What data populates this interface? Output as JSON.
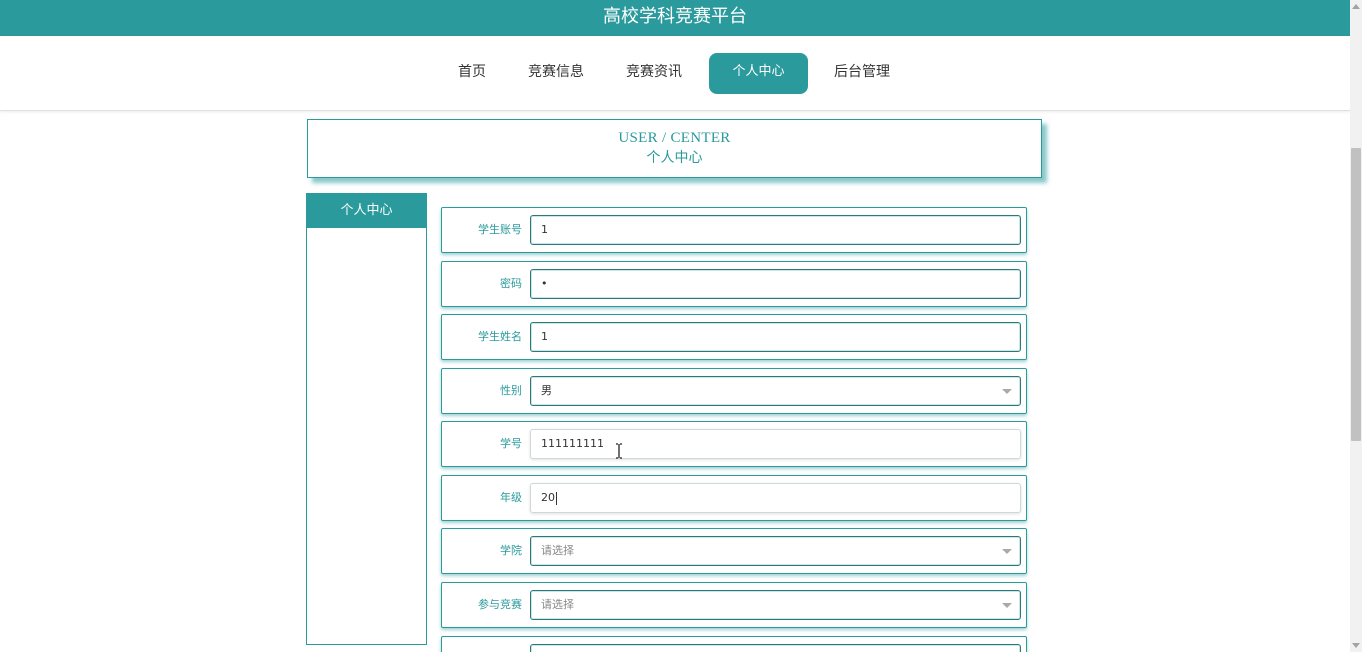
{
  "header": {
    "title": "高校学科竞赛平台"
  },
  "nav": {
    "items": [
      {
        "label": "首页"
      },
      {
        "label": "竞赛信息"
      },
      {
        "label": "竞赛资讯"
      },
      {
        "label": "个人中心",
        "active": true
      },
      {
        "label": "后台管理"
      }
    ]
  },
  "banner": {
    "en": "USER / CENTER",
    "cn": "个人中心"
  },
  "sidebar": {
    "items": [
      {
        "label": "个人中心"
      }
    ]
  },
  "form": {
    "rows": [
      {
        "label": "学生账号",
        "value": "1",
        "type": "text"
      },
      {
        "label": "密码",
        "value": "•",
        "type": "password"
      },
      {
        "label": "学生姓名",
        "value": "1",
        "type": "text"
      },
      {
        "label": "性别",
        "value": "男",
        "type": "select"
      },
      {
        "label": "学号",
        "value": "111111111",
        "type": "text"
      },
      {
        "label": "年级",
        "value": "20",
        "type": "text"
      },
      {
        "label": "学院",
        "value": "请选择",
        "type": "select",
        "placeholder": true
      },
      {
        "label": "参与竞赛",
        "value": "请选择",
        "type": "select",
        "placeholder": true
      }
    ]
  },
  "colors": {
    "accent": "#2a9a9c",
    "text": "#333333"
  }
}
